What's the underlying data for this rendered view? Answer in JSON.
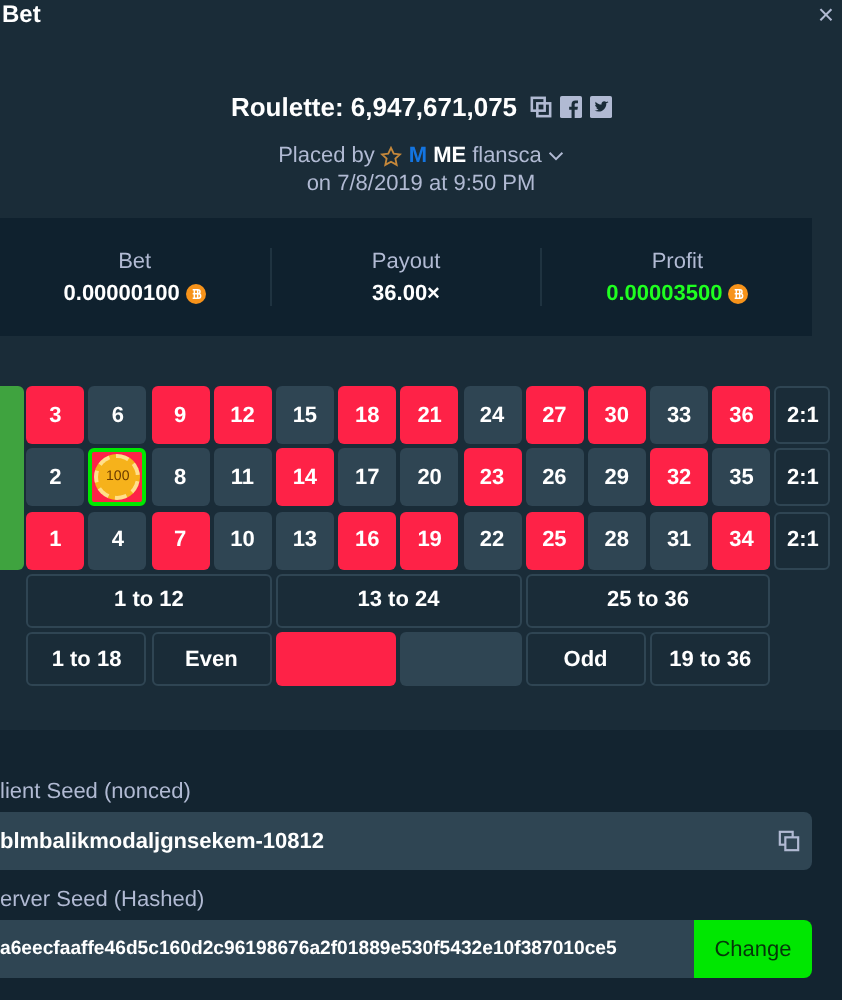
{
  "header": {
    "title": "Bet",
    "close": "×"
  },
  "bet": {
    "game": "Roulette: 6,947,671,075",
    "placed_by_label": "Placed by",
    "user_rank": "M",
    "user_badge": "ME",
    "username": "flansca",
    "date": "on 7/8/2019 at 9:50 PM"
  },
  "stats": [
    {
      "label": "Bet",
      "value": "0.00000100",
      "kind": "coin",
      "positive": false
    },
    {
      "label": "Payout",
      "value": "36.00×",
      "kind": "plain",
      "positive": false
    },
    {
      "label": "Profit",
      "value": "0.00003500",
      "kind": "coin",
      "positive": true
    }
  ],
  "board": {
    "lines": [
      {
        "numbers": [
          {
            "number": "3",
            "kind": "red",
            "winning": false
          },
          {
            "number": "6",
            "kind": "black",
            "winning": false
          },
          {
            "number": "9",
            "kind": "red",
            "winning": false
          },
          {
            "number": "12",
            "kind": "red",
            "winning": false
          },
          {
            "number": "15",
            "kind": "black",
            "winning": false
          },
          {
            "number": "18",
            "kind": "red",
            "winning": false
          },
          {
            "number": "21",
            "kind": "red",
            "winning": false
          },
          {
            "number": "24",
            "kind": "black",
            "winning": false
          },
          {
            "number": "27",
            "kind": "red",
            "winning": false
          },
          {
            "number": "30",
            "kind": "red",
            "winning": false
          },
          {
            "number": "33",
            "kind": "black",
            "winning": false
          },
          {
            "number": "36",
            "kind": "red",
            "winning": false
          }
        ],
        "column_bet": "2:1"
      },
      {
        "numbers": [
          {
            "number": "2",
            "kind": "black",
            "winning": false
          },
          {
            "kind": "red",
            "chip": "100",
            "winning": true
          },
          {
            "number": "8",
            "kind": "black",
            "winning": false
          },
          {
            "number": "11",
            "kind": "black",
            "winning": false
          },
          {
            "number": "14",
            "kind": "red",
            "winning": false
          },
          {
            "number": "17",
            "kind": "black",
            "winning": false
          },
          {
            "number": "20",
            "kind": "black",
            "winning": false
          },
          {
            "number": "23",
            "kind": "red",
            "winning": false
          },
          {
            "number": "26",
            "kind": "black",
            "winning": false
          },
          {
            "number": "29",
            "kind": "black",
            "winning": false
          },
          {
            "number": "32",
            "kind": "red",
            "winning": false
          },
          {
            "number": "35",
            "kind": "black",
            "winning": false
          }
        ],
        "column_bet": "2:1"
      },
      {
        "numbers": [
          {
            "number": "1",
            "kind": "red",
            "winning": false
          },
          {
            "number": "4",
            "kind": "black",
            "winning": false
          },
          {
            "number": "7",
            "kind": "red",
            "winning": false
          },
          {
            "number": "10",
            "kind": "black",
            "winning": false
          },
          {
            "number": "13",
            "kind": "black",
            "winning": false
          },
          {
            "number": "16",
            "kind": "red",
            "winning": false
          },
          {
            "number": "19",
            "kind": "red",
            "winning": false
          },
          {
            "number": "22",
            "kind": "black",
            "winning": false
          },
          {
            "number": "25",
            "kind": "red",
            "winning": false
          },
          {
            "number": "28",
            "kind": "black",
            "winning": false
          },
          {
            "number": "31",
            "kind": "black",
            "winning": false
          },
          {
            "number": "34",
            "kind": "red",
            "winning": false
          }
        ],
        "column_bet": "2:1"
      }
    ],
    "dozens": [
      "1 to 12",
      "13 to 24",
      "25 to 36"
    ],
    "outside": [
      {
        "kind": "text",
        "label": "1 to 18"
      },
      {
        "kind": "text",
        "label": "Even"
      },
      {
        "kind": "red"
      },
      {
        "kind": "black"
      },
      {
        "kind": "text",
        "label": "Odd"
      },
      {
        "kind": "text",
        "label": "19 to 36"
      }
    ]
  },
  "seeds": [
    {
      "label": "lient Seed (nonced)",
      "value": "blmbalikmodaljgnsekem-10812",
      "kind": "copy"
    },
    {
      "label": "erver Seed (Hashed)",
      "value": "a6eecfaaffe46d5c160d2c96198676a2f01889e530f5432e10f387010ce5",
      "kind": "change",
      "button": "Change"
    }
  ]
}
